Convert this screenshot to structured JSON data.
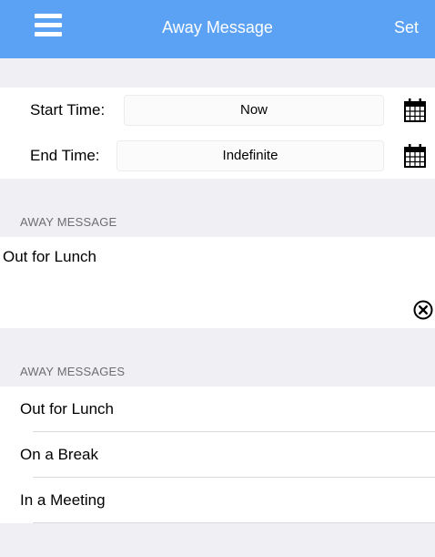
{
  "nav": {
    "title": "Away Message",
    "set_label": "Set",
    "menu_icon": "hamburger-menu-icon"
  },
  "times": {
    "start_label": "Start Time:",
    "start_value": "Now",
    "end_label": "End Time:",
    "end_value": "Indefinite",
    "picker_icon": "calendar-icon"
  },
  "message": {
    "section_label": "AWAY MESSAGE",
    "value": "Out for Lunch",
    "clear_icon": "clear-circle-x-icon"
  },
  "messages": {
    "section_label": "AWAY MESSAGES",
    "items": [
      {
        "label": "Out for Lunch"
      },
      {
        "label": "On a Break"
      },
      {
        "label": "In a Meeting"
      }
    ]
  },
  "colors": {
    "nav_bg": "#5ba2f4",
    "page_bg": "#efeff4"
  }
}
